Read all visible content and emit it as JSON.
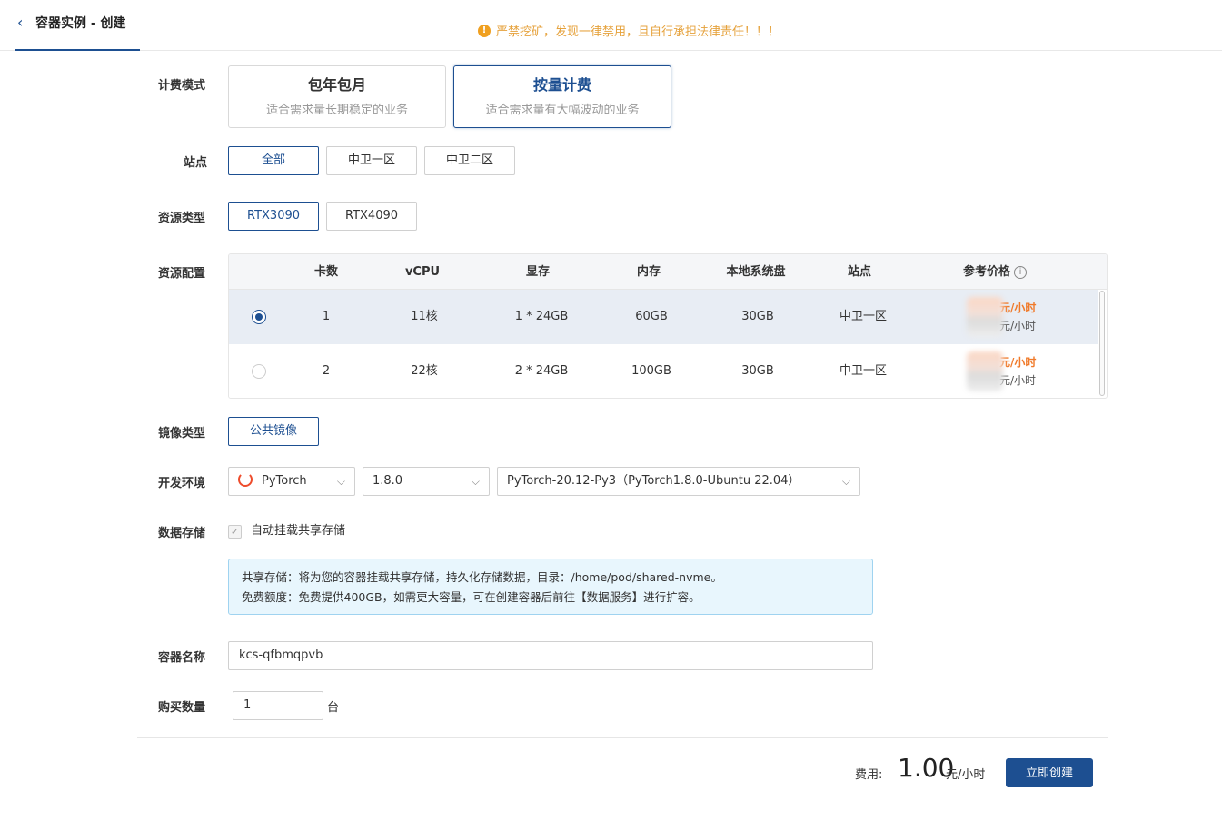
{
  "header": {
    "title": "容器实例 - 创建",
    "warning": "严禁挖矿，发现一律禁用，且自行承担法律责任！！！"
  },
  "labels": {
    "billing": "计费模式",
    "site": "站点",
    "resource_type": "资源类型",
    "resource_config": "资源配置",
    "image_type": "镜像类型",
    "dev_env": "开发环境",
    "storage": "数据存储",
    "container_name": "容器名称",
    "quantity": "购买数量"
  },
  "billing": {
    "options": [
      {
        "title": "包年包月",
        "desc": "适合需求量长期稳定的业务",
        "selected": false
      },
      {
        "title": "按量计费",
        "desc": "适合需求量有大幅波动的业务",
        "selected": true
      }
    ]
  },
  "sites": {
    "options": [
      "全部",
      "中卫一区",
      "中卫二区"
    ],
    "selected": "全部"
  },
  "resource_types": {
    "options": [
      "RTX3090",
      "RTX4090"
    ],
    "selected": "RTX3090"
  },
  "table": {
    "headers": [
      "卡数",
      "vCPU",
      "显存",
      "内存",
      "本地系统盘",
      "站点",
      "参考价格"
    ],
    "rows": [
      {
        "cards": "1",
        "vcpu": "11核",
        "vram": "1 * 24GB",
        "mem": "60GB",
        "disk": "30GB",
        "site": "中卫一区",
        "price1": "元/小时",
        "price2": "元/小时",
        "selected": true
      },
      {
        "cards": "2",
        "vcpu": "22核",
        "vram": "2 * 24GB",
        "mem": "100GB",
        "disk": "30GB",
        "site": "中卫一区",
        "price1": "元/小时",
        "price2": "元/小时",
        "selected": false
      }
    ]
  },
  "image_type": {
    "option": "公共镜像"
  },
  "dev_env": {
    "framework": "PyTorch",
    "version": "1.8.0",
    "image": "PyTorch-20.12-Py3（PyTorch1.8.0-Ubuntu 22.04）"
  },
  "storage": {
    "checkbox_label": "自动挂载共享存储",
    "checked": true,
    "notice_line1": "共享存储：将为您的容器挂载共享存储，持久化存储数据，目录：/home/pod/shared-nvme。",
    "notice_line2": "免费额度：免费提供400GB，如需更大容量，可在创建容器后前往【数据服务】进行扩容。"
  },
  "container_name": {
    "value": "kcs-qfbmqpvb"
  },
  "quantity": {
    "value": "1",
    "unit": "台"
  },
  "footer": {
    "fee_label": "费用:",
    "fee_amount": "1.00",
    "fee_unit": "元/小时",
    "create_label": "立即创建"
  },
  "colors": {
    "primary": "#1d4f91",
    "warning": "#e6a23c",
    "price": "#f07a2a",
    "notice_bg": "#e8f6fd"
  }
}
